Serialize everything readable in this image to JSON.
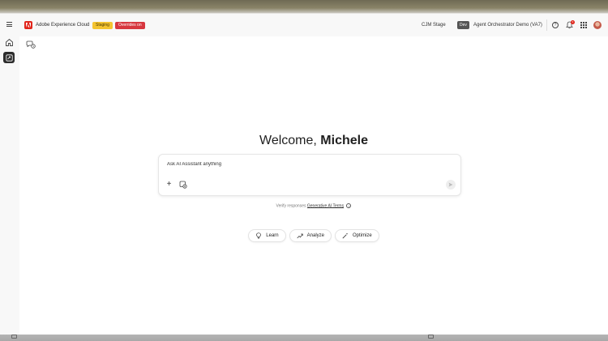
{
  "header": {
    "brand_name": "Adobe Experience Cloud",
    "staging_badge": "Staging",
    "overrides_badge": "Overrides on",
    "environment_label": "CJM Stage",
    "dev_badge": "Dev",
    "org_name": "Agent Orchestrator Demo (VA7)",
    "notification_count": "3",
    "help_glyph": "?"
  },
  "main": {
    "welcome_greeting": "Welcome,",
    "welcome_name": "Michele",
    "chat_placeholder": "Ask AI Assistant anything",
    "plus_glyph": "+",
    "disclaimer_text": "Verify responses",
    "disclaimer_link": "Generative AI Terms",
    "info_glyph": "i",
    "suggestions": [
      {
        "label": "Learn",
        "icon": "lightbulb-icon"
      },
      {
        "label": "Analyze",
        "icon": "trend-icon"
      },
      {
        "label": "Optimize",
        "icon": "magic-wand-icon"
      }
    ]
  },
  "colors": {
    "brand_red": "#e1251b",
    "staging_yellow": "#f4c430",
    "overrides_red": "#d7373f",
    "dev_badge_gray": "#555555"
  }
}
